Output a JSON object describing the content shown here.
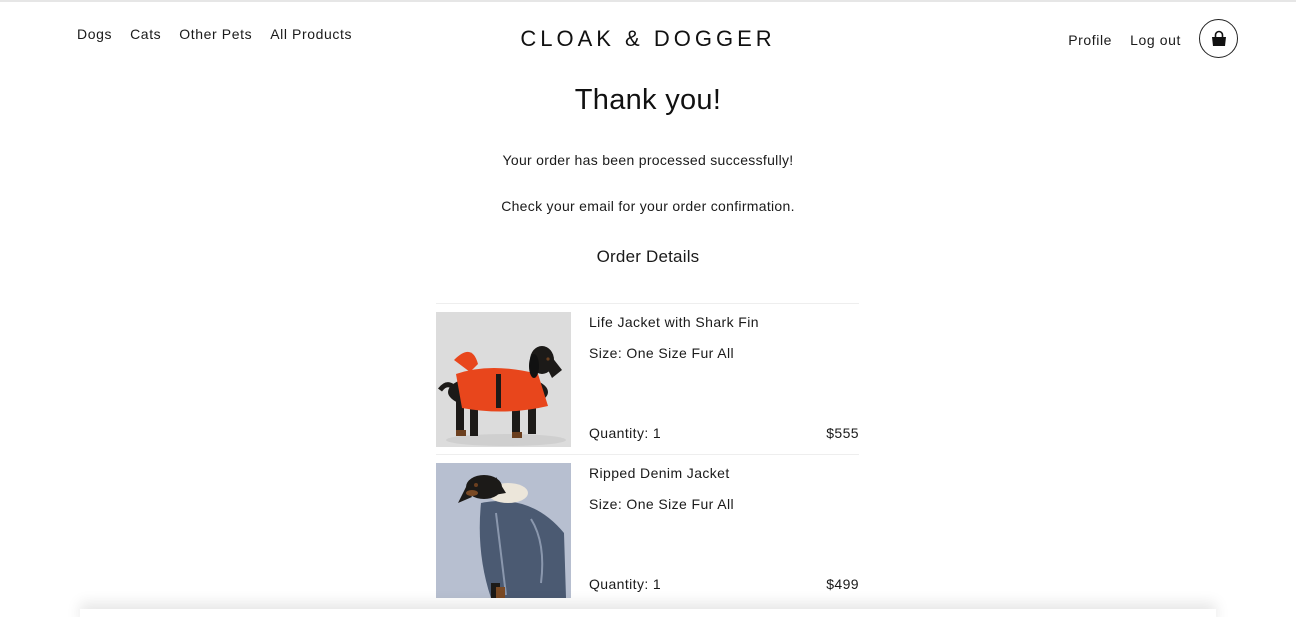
{
  "header": {
    "nav_left": [
      "Dogs",
      "Cats",
      "Other Pets",
      "All Products"
    ],
    "brand": "CLOAK & DOGGER",
    "nav_right": [
      "Profile",
      "Log out"
    ],
    "cart_icon": "shopping-bag-icon"
  },
  "main": {
    "title": "Thank you!",
    "message_processed": "Your order has been processed successfully!",
    "message_email": "Check your email for your order confirmation.",
    "details_heading": "Order Details"
  },
  "order_items": [
    {
      "name": "Life Jacket with Shark Fin",
      "size": "Size: One Size Fur All",
      "quantity": "Quantity: 1",
      "price": "$555",
      "image": "dachshund-in-orange-shark-fin-life-jacket"
    },
    {
      "name": "Ripped Denim Jacket",
      "size": "Size: One Size Fur All",
      "quantity": "Quantity: 1",
      "price": "$499",
      "image": "dachshund-in-denim-jacket"
    }
  ],
  "colors": {
    "text": "#1a1a1a",
    "divider": "#eeeeee",
    "life_jacket_orange": "#e8461c",
    "denim_blue": "#4b5a72",
    "photo_bg_grey": "#dcdcdc",
    "photo_bg_blue": "#b7bfd0"
  }
}
